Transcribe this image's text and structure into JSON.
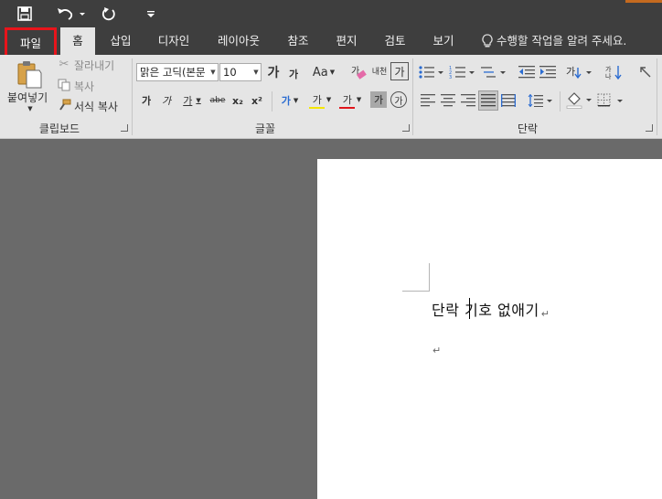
{
  "quick_access": {
    "save_icon": "save-icon",
    "undo_icon": "undo-icon",
    "redo_icon": "redo-icon",
    "customize_icon": "customize-qat-icon"
  },
  "tabs": {
    "file": "파일",
    "home": "홈",
    "insert": "삽입",
    "design": "디자인",
    "layout": "레이아웃",
    "references": "참조",
    "mailings": "편지",
    "review": "검토",
    "view": "보기",
    "tell_me": "수행할 작업을 알려 주세요."
  },
  "clipboard": {
    "paste": "붙여넣기",
    "cut": "잘라내기",
    "copy": "복사",
    "format_painter": "서식 복사",
    "label": "클립보드"
  },
  "font": {
    "family": "맑은 고딕(본문",
    "size": "10",
    "grow": "가",
    "shrink": "가",
    "case": "Aa",
    "clear_format": "가",
    "phonetic": "내천",
    "border": "가",
    "bold": "가",
    "italic": "가",
    "underline": "가",
    "strikethrough": "abe",
    "subscript": "x₂",
    "superscript": "x²",
    "text_effect": "가",
    "highlight": "가",
    "font_color": "가",
    "shading": "가",
    "enclosed": "가",
    "label": "글꼴"
  },
  "paragraph": {
    "label": "단락"
  },
  "document": {
    "line1_before_caret": "단락 ",
    "line1_after_caret": "기호 없애기",
    "para_mark": "↵"
  },
  "colors": {
    "title_bg": "#3e3e3e",
    "ribbon_bg": "#e5e5e5",
    "highlight_bar": "#f4e600",
    "font_color_bar": "#e0141b",
    "file_outline": "#e8141b"
  }
}
